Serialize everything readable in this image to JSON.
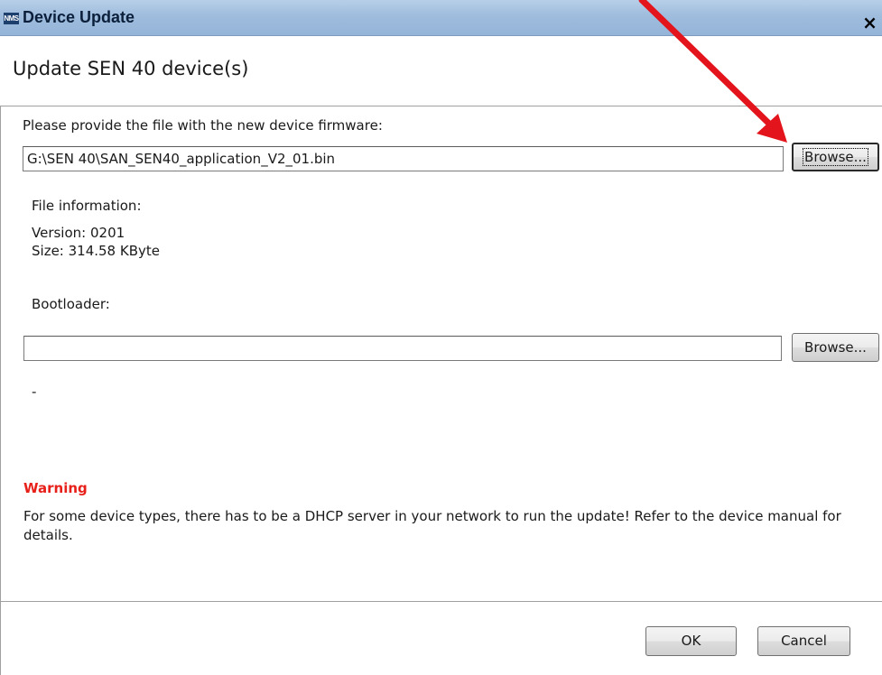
{
  "window": {
    "app_logo": "NMS",
    "title": "Device Update",
    "close_glyph": "×",
    "close_icon": "close-icon"
  },
  "header": {
    "title": "Update SEN 40 device(s)"
  },
  "firmware": {
    "prompt": "Please provide the file with the new device firmware:",
    "file_path": "G:\\SEN 40\\SAN_SEN40_application_V2_01.bin",
    "browse_label": "Browse..."
  },
  "file_info": {
    "heading": "File information:",
    "version": "Version: 0201",
    "size": "Size: 314.58 KByte"
  },
  "bootloader": {
    "label": "Bootloader:",
    "file_path": "",
    "browse_label": "Browse...",
    "info": "-"
  },
  "warning": {
    "title": "Warning",
    "text": "For some device types, there has to be a DHCP server in your network to run the update! Refer to the device manual for details."
  },
  "footer": {
    "ok_label": "OK",
    "cancel_label": "Cancel"
  },
  "colors": {
    "warning": "#e8201a",
    "annotation_arrow": "#e3141b",
    "titlebar": "#9fbcdd"
  }
}
